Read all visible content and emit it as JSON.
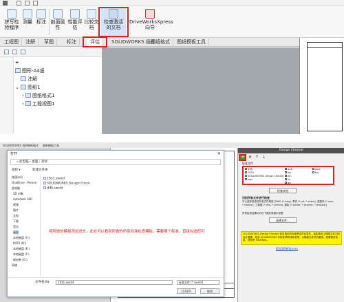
{
  "top": {
    "ribbon": {
      "buttons": [
        {
          "label": "拼写检\n验程序"
        },
        {
          "label": "测量"
        },
        {
          "label": "标注"
        },
        {
          "label": "剖面属\n性"
        },
        {
          "label": "性能评\n估"
        },
        {
          "label": "比较文\n档"
        },
        {
          "label": "检查激活\n的文档"
        },
        {
          "label": "DriveWorksXpress\n向导"
        }
      ]
    },
    "tabs": [
      "工程图",
      "注解",
      "草图",
      "标注",
      "评估",
      "SOLIDWORKS 插件",
      "图纸格式",
      "图纸模板工具"
    ],
    "tree": {
      "root": "图形-A4竖",
      "items": [
        "注解",
        "图纸1",
        "图纸格式1",
        "工程视图1"
      ]
    }
  },
  "bottom": {
    "tabs": [
      "SOLIDWORKS 插件",
      "图纸格式",
      "图纸模板工具"
    ],
    "dialog": {
      "title": "打开",
      "address": "« 此电脑 › 桌面 › 测试",
      "toolbar": {
        "organize": "组织 ▾",
        "new_folder": "新建文件夹"
      },
      "nav": [
        "快速访问",
        "OneDrive - Person",
        "此电脑",
        "3D 对象",
        "Autodesk 360",
        "视频",
        "图片",
        "文档",
        "下载",
        "音乐",
        "桌面",
        "本地磁盘 (C:)",
        "DATA (D:)",
        "本地磁盘 (E:)",
        "本地磁盘 (F:)",
        "新加卷 (G:)",
        "网络"
      ],
      "files": [
        "1931.swstd",
        "SOLIDWORKS Design Check",
        "手机.swstd"
      ],
      "annotation": "将所做的模板添加进去，此处可以看到所做的所有标准检查模板，需要哪个标准，直接勾选即可",
      "filename_label": "文件名(N):",
      "filename_value": "1931.swstd",
      "filetype_value": "标准文件 (*.swstd)",
      "open_btn": "打开(O)",
      "cancel_btn": "取消"
    },
    "panel": {
      "title": "Design Checker",
      "std_label": "标准文件",
      "standards_left": [
        "手机",
        "1931",
        "SOLIDWORKS design checker ✓",
        "test"
      ],
      "standards_mid": [
        "ansi",
        "iso",
        "din",
        "jis",
        "gb"
      ],
      "standards_right": [
        "gost",
        "bsi"
      ],
      "check_btn": "检查文档",
      "desc_title": "识别所有文件进行检查",
      "desc_body": "可以选择检查的所有文件类型 [DWG (*.dwg), 零件 (*.prt, *.sldprt), 装配体 (*.asm, *.sldasm), 工程图 (*.drw, *.slddrw), 模板 (*.prtdot, *.asmdot, *.drwdot)]",
      "desc_more": "所有检查结果均可在下面的表格中查看",
      "select_btn": "选择文件...",
      "yellow_text": "SOLIDWORKS Design Checker 验证指定的标准是否符合零件、装配体和工程图文件中的设计要素，检查 SOLIDWORKS 中标准项和非标准项，以确保文件符合要求。如需更多信息，请参考 SWXWeb。",
      "link": "提交到SWXpress"
    }
  }
}
